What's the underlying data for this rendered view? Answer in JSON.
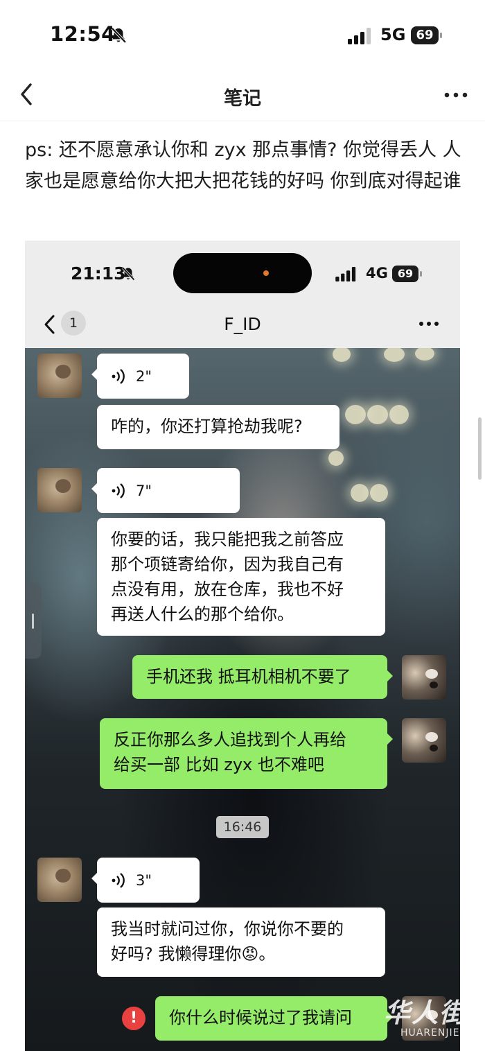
{
  "status_bar": {
    "time": "12:54",
    "network": "5G",
    "battery": "69",
    "icons": [
      "bell-slash-icon",
      "signal-icon",
      "battery-icon"
    ]
  },
  "nav": {
    "title": "笔记",
    "back_icon": "chevron-left-icon",
    "more_icon": "more-dots-icon"
  },
  "post": {
    "text": "ps: 还不愿意承认你和 zyx 那点事情? 你觉得丢人 人家也是愿意给你大把大把花钱的好吗 你到底对得起谁"
  },
  "screenshot": {
    "status_bar": {
      "time": "21:13",
      "network": "4G",
      "battery": "69"
    },
    "nav": {
      "unread_badge": "1",
      "title": "F_ID"
    },
    "messages": [
      {
        "side": "left",
        "type": "voice",
        "duration": "2\""
      },
      {
        "side": "left",
        "type": "text",
        "text": "咋的，你还打算抢劫我呢?"
      },
      {
        "side": "left",
        "type": "voice",
        "duration": "7\""
      },
      {
        "side": "left",
        "type": "text",
        "lines": [
          "你要的话，我只能把我之前答应",
          "那个项链寄给你，因为我自己有",
          "点没有用，放在仓库，我也不好",
          "再送人什么的那个给你。"
        ]
      },
      {
        "side": "right",
        "type": "text",
        "text": "手机还我 抵耳机相机不要了"
      },
      {
        "side": "right",
        "type": "text",
        "lines": [
          "反正你那么多人追找到个人再给",
          "给买一部 比如 zyx 也不难吧"
        ]
      },
      {
        "type": "timestamp",
        "text": "16:46"
      },
      {
        "side": "left",
        "type": "voice",
        "duration": "3\""
      },
      {
        "side": "left",
        "type": "text",
        "lines": [
          "我当时就问过你，你说你不要的",
          "好吗? 我懒得理你😡。"
        ]
      },
      {
        "side": "right",
        "type": "text",
        "text": "你什么时候说过了我请问",
        "failed": true,
        "error_mark": "!"
      }
    ],
    "colors": {
      "bubble_green": "#95ec69",
      "bubble_white": "#ffffff",
      "chrome": "#ededed"
    }
  },
  "watermark": {
    "main": "华人街",
    "sub": "HUARENJIE"
  }
}
